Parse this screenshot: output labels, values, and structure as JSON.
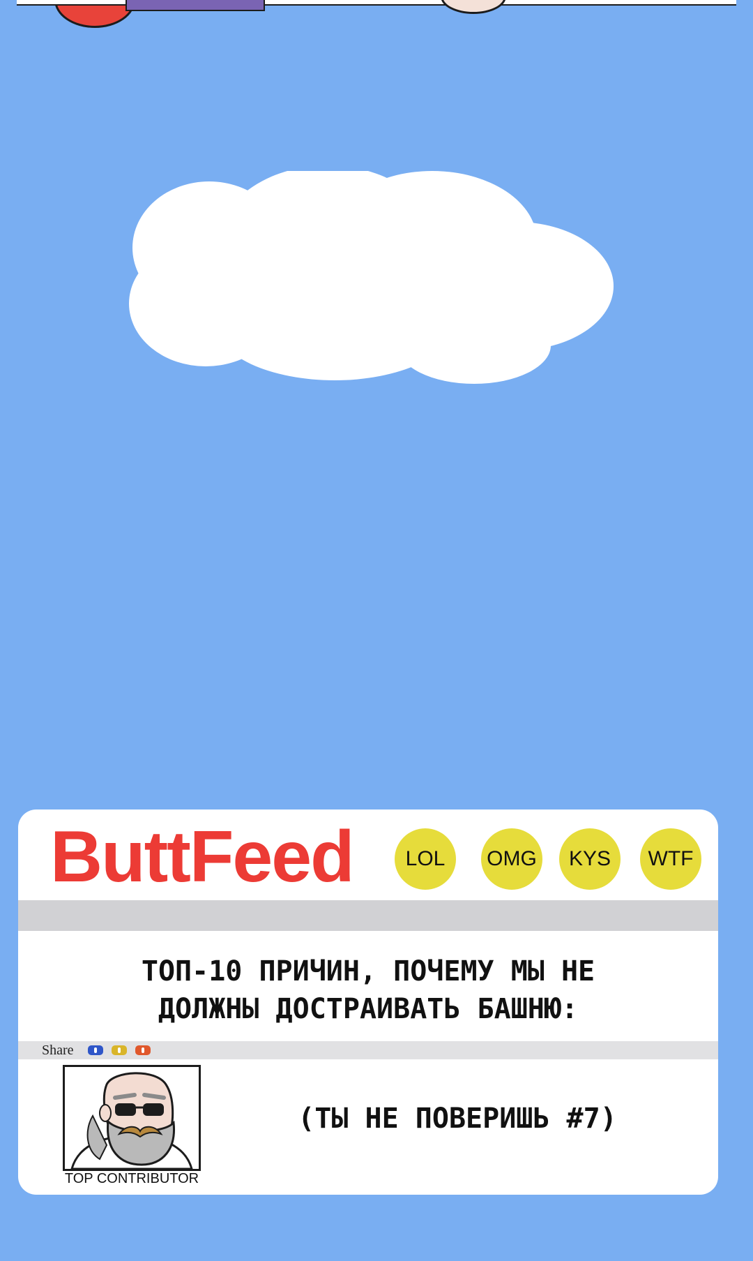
{
  "colors": {
    "sky": "#79aef2",
    "cloud": "#ffffff",
    "brand": "#ec3b35",
    "badge": "#e6dc3b",
    "bar": "#d1d1d4"
  },
  "card": {
    "brand": "ButtFeed",
    "reactions": [
      "LOL",
      "OMG",
      "KYS",
      "WTF"
    ],
    "headline_line1": "ТОП-10 ПРИЧИН, ПОЧЕМУ МЫ НЕ",
    "headline_line2": "ДОЛЖНЫ ДОСТРАИВАТЬ БАШНЮ:",
    "share_label": "Share",
    "share_icons": [
      {
        "name": "share-blue-icon",
        "color": "#2f56c8"
      },
      {
        "name": "share-yellow-icon",
        "color": "#d9b52a"
      },
      {
        "name": "share-orange-icon",
        "color": "#e0582c"
      }
    ],
    "avatar_icon": "bearded-man-avatar",
    "contributor_label": "TOP CONTRIBUTOR",
    "teaser": "(ТЫ НЕ ПОВЕРИШЬ #7)"
  }
}
